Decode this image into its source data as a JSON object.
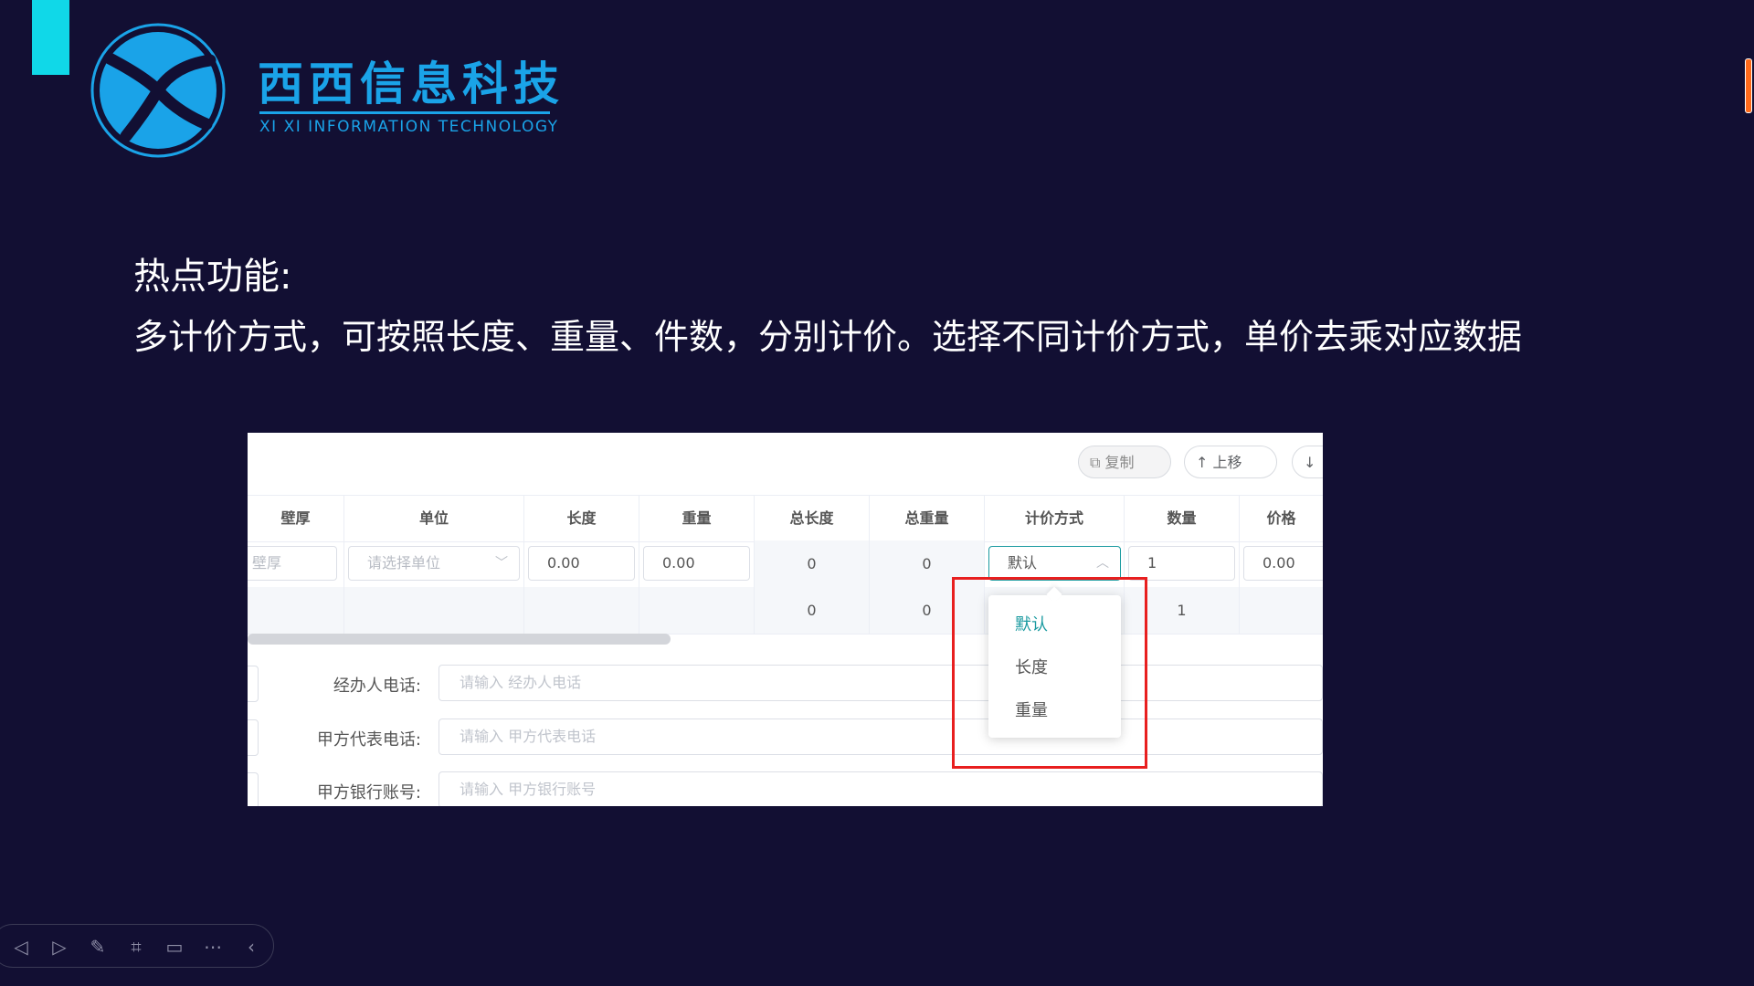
{
  "brand": {
    "name_cn": "西西信息科技",
    "name_en": "XI XI INFORMATION TECHNOLOGY",
    "color": "#1aa3e8"
  },
  "heading": "热点功能:",
  "description": "多计价方式，可按照长度、重量、件数，分别计价。选择不同计价方式，单价去乘对应数据",
  "screenshot": {
    "buttons": {
      "copy": "复制",
      "move_up": "上移",
      "move_down": "↓"
    },
    "columns": [
      "壁厚",
      "单位",
      "长度",
      "重量",
      "总长度",
      "总重量",
      "计价方式",
      "数量",
      "价格"
    ],
    "row1": {
      "wall_placeholder": "壁厚",
      "unit_placeholder": "请选择单位",
      "length": "0.00",
      "weight": "0.00",
      "total_length": "0",
      "total_weight": "0",
      "pricing": "默认",
      "quantity": "1",
      "price": "0.00"
    },
    "summary": {
      "total_length": "0",
      "total_weight": "0",
      "quantity": "1"
    },
    "dropdown_options": [
      "默认",
      "长度",
      "重量"
    ],
    "form": [
      {
        "label": "经办人电话:",
        "placeholder": "请输入 经办人电话"
      },
      {
        "label": "甲方代表电话:",
        "placeholder": "请输入 甲方代表电话"
      },
      {
        "label": "甲方银行账号:",
        "placeholder": "请输入 甲方银行账号"
      }
    ]
  },
  "toolbar_icons": [
    "prev-icon",
    "next-icon",
    "pen-icon",
    "focus-icon",
    "screen-icon",
    "more-icon",
    "collapse-icon"
  ],
  "colors": {
    "background": "#120f33",
    "accent": "#10d8e8",
    "highlight": "#e81f1f",
    "selected": "#1a9aa0"
  }
}
